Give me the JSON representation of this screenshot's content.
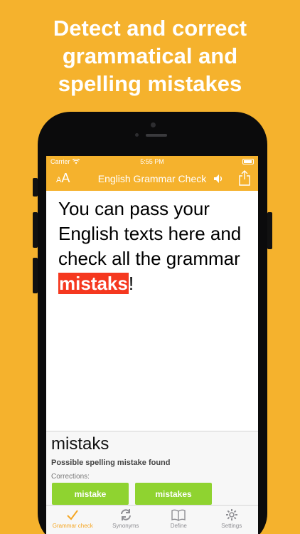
{
  "headline": {
    "line1": "Detect and correct",
    "line2": "grammatical and",
    "line3": "spelling mistakes"
  },
  "status_bar": {
    "carrier": "Carrier",
    "time": "5:55 PM"
  },
  "nav": {
    "font_button_small": "A",
    "font_button_large": "A",
    "title": "English Grammar Check"
  },
  "editor": {
    "text_before": "You can pass your English texts here and check all the grammar ",
    "error_word": "mistaks",
    "text_after": "!"
  },
  "panel": {
    "word": "mistaks",
    "message": "Possible spelling mistake found",
    "corrections_label": "Corrections:",
    "suggestions": [
      "mistake",
      "mistakes"
    ]
  },
  "tabs": [
    {
      "label": "Grammar check",
      "icon": "checkmark-icon",
      "active": true
    },
    {
      "label": "Synonyms",
      "icon": "sync-icon",
      "active": false
    },
    {
      "label": "Define",
      "icon": "book-icon",
      "active": false
    },
    {
      "label": "Settings",
      "icon": "gear-icon",
      "active": false
    }
  ],
  "colors": {
    "brand": "#f5b22d",
    "error_highlight": "#f5381f",
    "suggestion": "#8fd330",
    "tab_active": "#f5a623"
  }
}
